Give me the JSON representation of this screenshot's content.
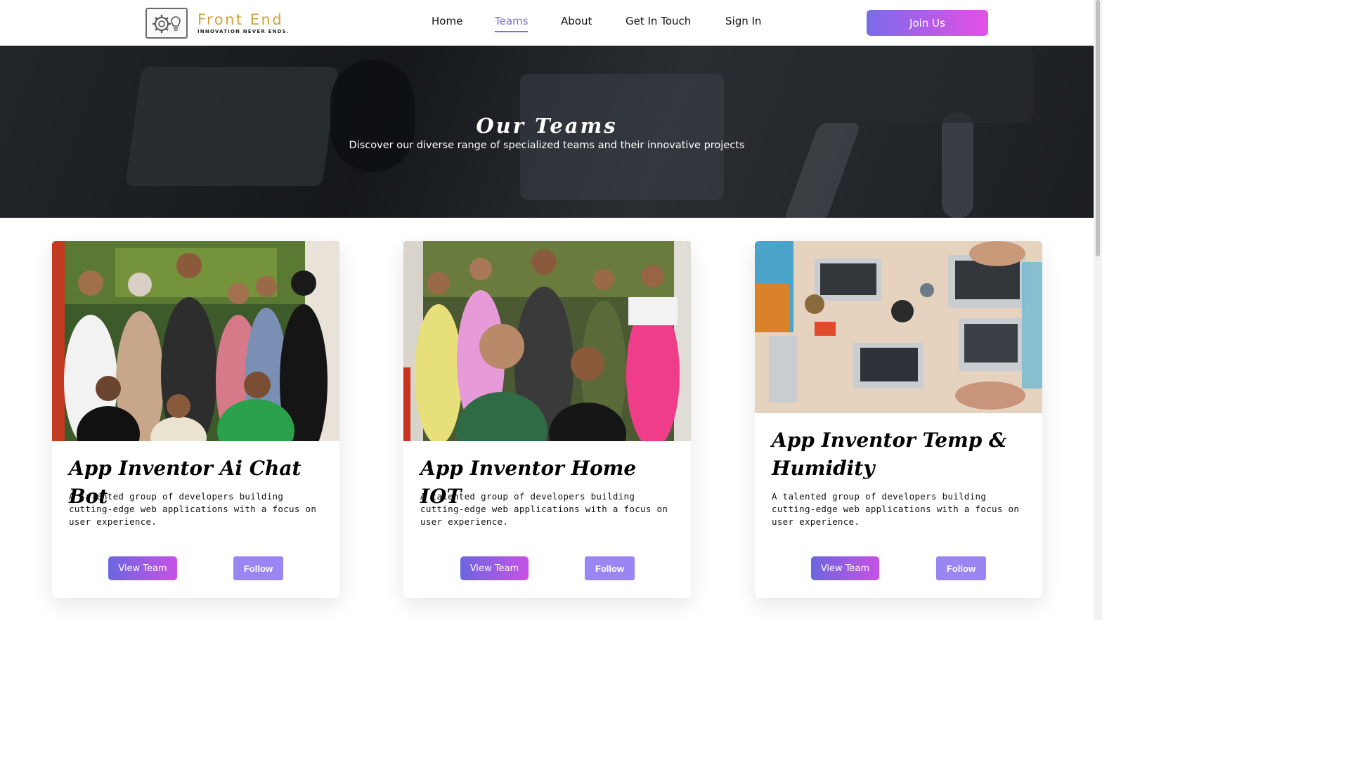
{
  "brand": {
    "name": "Front End",
    "tagline": "INNOVATION NEVER ENDS."
  },
  "nav": {
    "links": [
      "Home",
      "Teams",
      "About",
      "Get In Touch",
      "Sign In"
    ],
    "active": "Teams",
    "cta": "Join Us"
  },
  "hero": {
    "title": "Our Teams",
    "subtitle": "Discover our diverse range of specialized teams and their innovative projects"
  },
  "teams": [
    {
      "title": "App Inventor Ai Chat Bot",
      "description": "A talented group of developers building cutting-edge web applications with a focus on user experience.",
      "view_label": "View Team",
      "follow_label": "Follow",
      "image": "team-group-photo"
    },
    {
      "title": "App Inventor Home IOT",
      "description": "A talented group of developers building cutting-edge web applications with a focus on user experience.",
      "view_label": "View Team",
      "follow_label": "Follow",
      "image": "team-group-photo"
    },
    {
      "title": "App Inventor Temp & Humidity",
      "description": "A talented group of developers building cutting-edge web applications with a focus on user experience.",
      "view_label": "View Team",
      "follow_label": "Follow",
      "image": "workspace-laptops-photo"
    }
  ],
  "colors": {
    "accent": "#7a6ce8",
    "gradient_end": "#e54fe6",
    "brand_gold": "#d4a23a",
    "follow": "#9a85f3"
  }
}
